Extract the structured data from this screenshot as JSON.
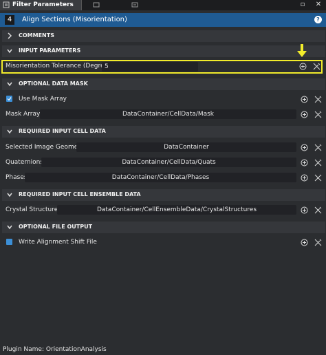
{
  "tabs": {
    "active_title": "Filter Parameters"
  },
  "filter": {
    "index": "4",
    "name": "Align Sections (Misorientation)"
  },
  "sections": {
    "comments": "COMMENTS",
    "input_parameters": "INPUT PARAMETERS",
    "optional_data_mask": "OPTIONAL DATA MASK",
    "required_input_cell_data": "REQUIRED INPUT CELL DATA",
    "required_input_cell_ensemble_data": "REQUIRED INPUT CELL ENSEMBLE DATA",
    "optional_file_output": "OPTIONAL FILE OUTPUT"
  },
  "parameters": {
    "misorientation_label": "Misorientation Tolerance (Degrees)",
    "misorientation_value": "5",
    "use_mask_label": "Use Mask Array",
    "mask_array_label": "Mask Array",
    "mask_array_value": "DataContainer/CellData/Mask",
    "image_geometry_label": "Selected Image Geometry",
    "image_geometry_value": "DataContainer",
    "quaternions_label": "Quaternions",
    "quaternions_value": "DataContainer/CellData/Quats",
    "phases_label": "Phases",
    "phases_value": "DataContainer/CellData/Phases",
    "crystal_structures_label": "Crystal Structures",
    "crystal_structures_value": "DataContainer/CellEnsembleData/CrystalStructures",
    "write_shift_label": "Write Alignment Shift File"
  },
  "footer": {
    "plugin_name": "Plugin Name: OrientationAnalysis"
  },
  "colors": {
    "header_blue": "#1f5b93",
    "highlight_yellow": "#f2ec2b",
    "checkbox_blue": "#3c8fd6"
  }
}
